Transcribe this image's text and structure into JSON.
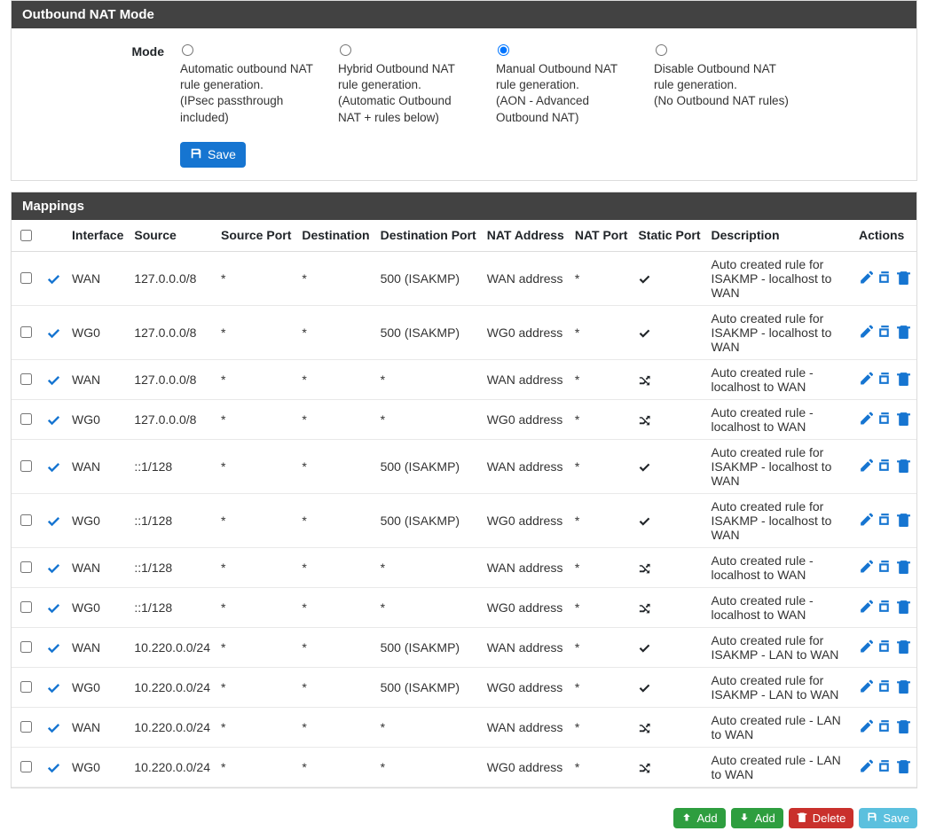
{
  "nat_mode_panel": {
    "title": "Outbound NAT Mode",
    "mode_label": "Mode",
    "save_label": "Save",
    "selected_index": 2,
    "options": [
      {
        "line1": "Automatic outbound NAT",
        "line2": "rule generation.",
        "line3": "(IPsec passthrough",
        "line4": "included)"
      },
      {
        "line1": "Hybrid Outbound NAT",
        "line2": "rule generation.",
        "line3": "(Automatic Outbound",
        "line4": "NAT + rules below)"
      },
      {
        "line1": "Manual Outbound NAT",
        "line2": "rule generation.",
        "line3": "(AON - Advanced",
        "line4": "Outbound NAT)"
      },
      {
        "line1": "Disable Outbound NAT",
        "line2": "rule generation.",
        "line3": "(No Outbound NAT rules)",
        "line4": ""
      }
    ]
  },
  "mappings_panel": {
    "title": "Mappings",
    "columns": {
      "interface": "Interface",
      "source": "Source",
      "source_port": "Source Port",
      "destination": "Destination",
      "destination_port": "Destination Port",
      "nat_address": "NAT Address",
      "nat_port": "NAT Port",
      "static_port": "Static Port",
      "description": "Description",
      "actions": "Actions"
    },
    "rows": [
      {
        "interface": "WAN",
        "source": "127.0.0.0/8",
        "src_port": "*",
        "dest": "*",
        "dest_port": "500 (ISAKMP)",
        "nat_addr": "WAN address",
        "nat_port": "*",
        "static_port": "check",
        "desc": "Auto created rule for ISAKMP - localhost to WAN"
      },
      {
        "interface": "WG0",
        "source": "127.0.0.0/8",
        "src_port": "*",
        "dest": "*",
        "dest_port": "500 (ISAKMP)",
        "nat_addr": "WG0 address",
        "nat_port": "*",
        "static_port": "check",
        "desc": "Auto created rule for ISAKMP - localhost to WAN"
      },
      {
        "interface": "WAN",
        "source": "127.0.0.0/8",
        "src_port": "*",
        "dest": "*",
        "dest_port": "*",
        "nat_addr": "WAN address",
        "nat_port": "*",
        "static_port": "shuffle",
        "desc": "Auto created rule - localhost to WAN"
      },
      {
        "interface": "WG0",
        "source": "127.0.0.0/8",
        "src_port": "*",
        "dest": "*",
        "dest_port": "*",
        "nat_addr": "WG0 address",
        "nat_port": "*",
        "static_port": "shuffle",
        "desc": "Auto created rule - localhost to WAN"
      },
      {
        "interface": "WAN",
        "source": "::1/128",
        "src_port": "*",
        "dest": "*",
        "dest_port": "500 (ISAKMP)",
        "nat_addr": "WAN address",
        "nat_port": "*",
        "static_port": "check",
        "desc": "Auto created rule for ISAKMP - localhost to WAN"
      },
      {
        "interface": "WG0",
        "source": "::1/128",
        "src_port": "*",
        "dest": "*",
        "dest_port": "500 (ISAKMP)",
        "nat_addr": "WG0 address",
        "nat_port": "*",
        "static_port": "check",
        "desc": "Auto created rule for ISAKMP - localhost to WAN"
      },
      {
        "interface": "WAN",
        "source": "::1/128",
        "src_port": "*",
        "dest": "*",
        "dest_port": "*",
        "nat_addr": "WAN address",
        "nat_port": "*",
        "static_port": "shuffle",
        "desc": "Auto created rule - localhost to WAN"
      },
      {
        "interface": "WG0",
        "source": "::1/128",
        "src_port": "*",
        "dest": "*",
        "dest_port": "*",
        "nat_addr": "WG0 address",
        "nat_port": "*",
        "static_port": "shuffle",
        "desc": "Auto created rule - localhost to WAN"
      },
      {
        "interface": "WAN",
        "source": "10.220.0.0/24",
        "src_port": "*",
        "dest": "*",
        "dest_port": "500 (ISAKMP)",
        "nat_addr": "WAN address",
        "nat_port": "*",
        "static_port": "check",
        "desc": "Auto created rule for ISAKMP - LAN to WAN"
      },
      {
        "interface": "WG0",
        "source": "10.220.0.0/24",
        "src_port": "*",
        "dest": "*",
        "dest_port": "500 (ISAKMP)",
        "nat_addr": "WG0 address",
        "nat_port": "*",
        "static_port": "check",
        "desc": "Auto created rule for ISAKMP - LAN to WAN"
      },
      {
        "interface": "WAN",
        "source": "10.220.0.0/24",
        "src_port": "*",
        "dest": "*",
        "dest_port": "*",
        "nat_addr": "WAN address",
        "nat_port": "*",
        "static_port": "shuffle",
        "desc": "Auto created rule - LAN to WAN"
      },
      {
        "interface": "WG0",
        "source": "10.220.0.0/24",
        "src_port": "*",
        "dest": "*",
        "dest_port": "*",
        "nat_addr": "WG0 address",
        "nat_port": "*",
        "static_port": "shuffle",
        "desc": "Auto created rule - LAN to WAN"
      }
    ]
  },
  "bottom_buttons": {
    "add_top": "Add",
    "add_bottom": "Add",
    "delete": "Delete",
    "save": "Save"
  },
  "icons": {
    "state_enabled": "check-icon",
    "row_edit": "pencil-icon",
    "row_copy": "copy-icon",
    "row_delete": "trash-icon"
  },
  "colors": {
    "accent": "#1675d1",
    "panel_header": "#424242",
    "success": "#2e9e3f",
    "danger": "#c9302c",
    "info": "#5bc0de"
  }
}
